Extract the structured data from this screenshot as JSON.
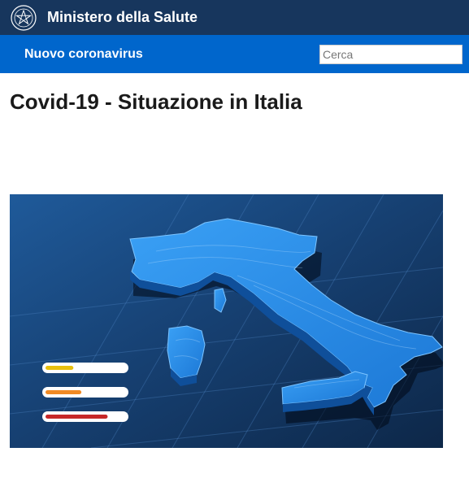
{
  "header": {
    "ministry_name": "Ministero della Salute",
    "emblem_icon": "italian-republic-emblem-icon"
  },
  "subheader": {
    "section_title": "Nuovo coronavirus",
    "search": {
      "placeholder": "Cerca",
      "value": ""
    }
  },
  "main": {
    "page_title": "Covid-19 - Situazione in Italia"
  },
  "hero": {
    "image_subject": "italy-3d-map-illustration",
    "indicators": [
      {
        "color": "#e8c00e",
        "level": 0.35
      },
      {
        "color": "#f08a24",
        "level": 0.45
      },
      {
        "color": "#c62828",
        "level": 0.78
      }
    ]
  },
  "colors": {
    "header_bg": "#17365d",
    "subheader_bg": "#0066cc",
    "hero_bg": "#163a66",
    "map_fill": "#2b8ee8"
  }
}
